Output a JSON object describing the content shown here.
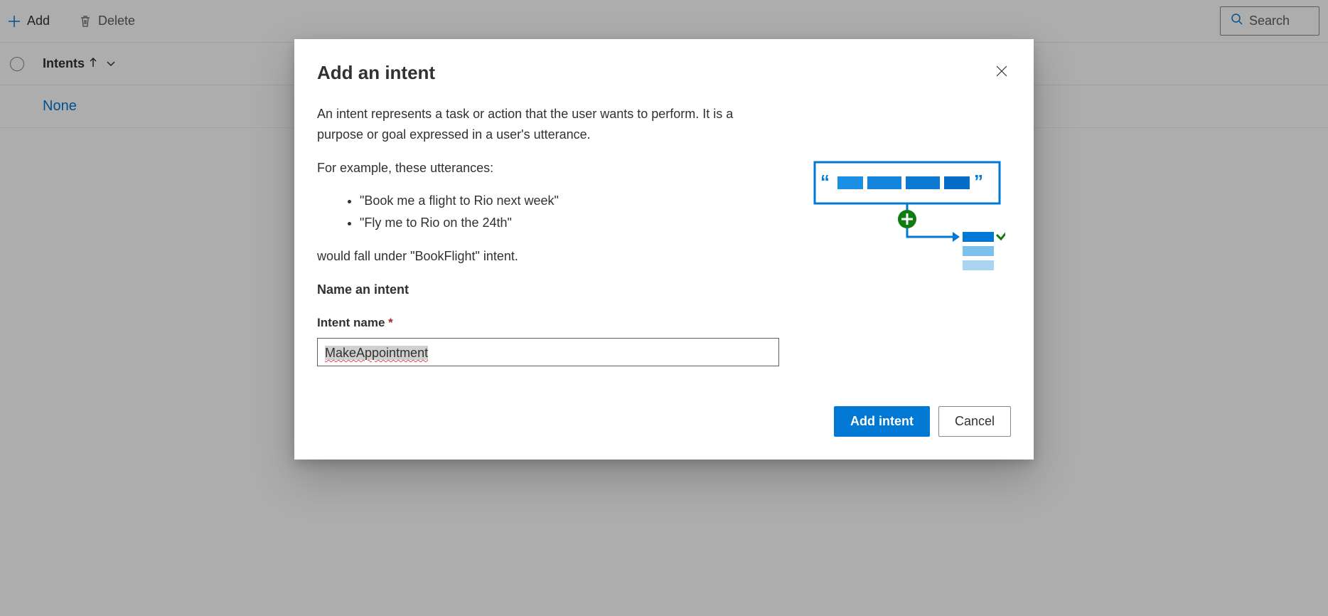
{
  "toolbar": {
    "add_label": "Add",
    "delete_label": "Delete",
    "search_placeholder": "Search"
  },
  "table": {
    "header": "Intents",
    "rows": [
      {
        "name": "None"
      }
    ]
  },
  "modal": {
    "title": "Add an intent",
    "description": "An intent represents a task or action that the user wants to perform. It is a purpose or goal expressed in a user's utterance.",
    "example_intro": "For example, these utterances:",
    "examples": [
      "\"Book me a flight to Rio next week\"",
      "\"Fly me to Rio on the 24th\""
    ],
    "example_outro": "would fall under \"BookFlight\" intent.",
    "section_label": "Name an intent",
    "field_label": "Intent name",
    "field_value": "MakeAppointment",
    "primary_btn": "Add intent",
    "secondary_btn": "Cancel"
  }
}
